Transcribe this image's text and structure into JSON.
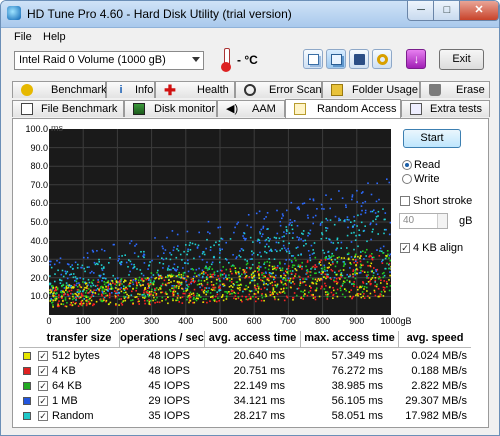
{
  "window": {
    "title": "HD Tune Pro 4.60 - Hard Disk Utility (trial version)",
    "min_glyph": "─",
    "max_glyph": "□",
    "close_glyph": "✕"
  },
  "menu": [
    "File",
    "Help"
  ],
  "toolbar": {
    "drive": "Intel   Raid 0 Volume (1000 gB)",
    "temperature": "- °C",
    "exit_label": "Exit",
    "buttons": [
      "copy-info",
      "copy-screenshot",
      "save",
      "options",
      "download"
    ]
  },
  "tabs_top": [
    "Benchmark",
    "Info",
    "Health",
    "Error Scan",
    "Folder Usage",
    "Erase"
  ],
  "tabs_bottom": [
    "File Benchmark",
    "Disk monitor",
    "AAM",
    "Random Access",
    "Extra tests"
  ],
  "active_tab": "Random Access",
  "controls": {
    "start_label": "Start",
    "read_label": "Read",
    "write_label": "Write",
    "mode": "Read",
    "short_stroke_label": "Short stroke",
    "short_stroke_checked": false,
    "short_stroke_value": "40",
    "short_stroke_unit": "gB",
    "align_label": "4 KB align",
    "align_checked": true
  },
  "chart_data": {
    "type": "scatter",
    "ylabel": "ms",
    "xlabel": "",
    "x_unit": "gB",
    "ylim": [
      0,
      100
    ],
    "xlim": [
      0,
      1000
    ],
    "y_ticks": [
      "100.0",
      "90.0",
      "80.0",
      "70.0",
      "60.0",
      "50.0",
      "40.0",
      "30.0",
      "20.0",
      "10.0"
    ],
    "x_ticks": [
      "0",
      "100",
      "200",
      "300",
      "400",
      "500",
      "600",
      "700",
      "800",
      "900",
      "1000gB"
    ],
    "grid": true,
    "background": "#1a1a1a",
    "series": [
      {
        "name": "512 bytes",
        "color": "#e6e600",
        "trend_ms": [
          10,
          22
        ]
      },
      {
        "name": "4 KB",
        "color": "#ff2222",
        "trend_ms": [
          10,
          22
        ]
      },
      {
        "name": "64 KB",
        "color": "#22cc22",
        "trend_ms": [
          11,
          24
        ]
      },
      {
        "name": "1 MB",
        "color": "#2d6bff",
        "trend_ms": [
          20,
          48
        ]
      },
      {
        "name": "Random",
        "color": "#20d0d0",
        "trend_ms": [
          17,
          38
        ]
      }
    ]
  },
  "table": {
    "headers": [
      "transfer size",
      "operations / sec",
      "avg. access time",
      "max. access time",
      "avg. speed"
    ],
    "rows": [
      {
        "label": "512 bytes",
        "color": "#e6e600",
        "checked": true,
        "ops": "48 IOPS",
        "avg": "20.640 ms",
        "max": "57.349 ms",
        "speed": "0.024 MB/s"
      },
      {
        "label": "4 KB",
        "color": "#e02020",
        "checked": true,
        "ops": "48 IOPS",
        "avg": "20.751 ms",
        "max": "76.272 ms",
        "speed": "0.188 MB/s"
      },
      {
        "label": "64 KB",
        "color": "#22aa22",
        "checked": true,
        "ops": "45 IOPS",
        "avg": "22.149 ms",
        "max": "38.985 ms",
        "speed": "2.822 MB/s"
      },
      {
        "label": "1 MB",
        "color": "#2255dd",
        "checked": true,
        "ops": "29 IOPS",
        "avg": "34.121 ms",
        "max": "56.105 ms",
        "speed": "29.307 MB/s"
      },
      {
        "label": "Random",
        "color": "#20c8c8",
        "checked": true,
        "ops": "35 IOPS",
        "avg": "28.217 ms",
        "max": "58.051 ms",
        "speed": "17.982 MB/s"
      }
    ]
  }
}
